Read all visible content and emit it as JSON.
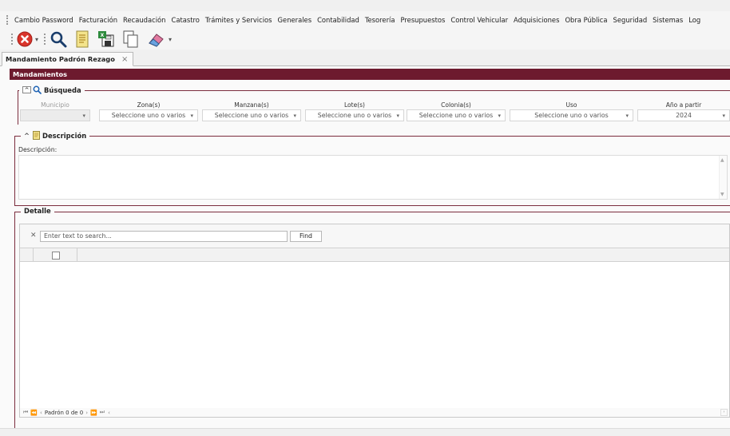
{
  "menu": {
    "items": [
      "Cambio Password",
      "Facturación",
      "Recaudación",
      "Catastro",
      "Trámites y Servicios",
      "Generales",
      "Contabilidad",
      "Tesorería",
      "Presupuestos",
      "Control Vehicular",
      "Adquisiciones",
      "Obra Pública",
      "Seguridad",
      "Sistemas",
      "Log"
    ]
  },
  "toolbar": {
    "icons": [
      "close-red-icon",
      "search-icon",
      "notepad-icon",
      "save-excel-icon",
      "copy-pages-icon",
      "eraser-icon"
    ]
  },
  "tab": {
    "label": "Mandamiento Padrón Rezago",
    "close": "×"
  },
  "header": {
    "title": "Mandamientos"
  },
  "busqueda": {
    "legend": "Búsqueda",
    "fields": {
      "municipio": {
        "label": "Municipio",
        "value": ""
      },
      "zona": {
        "label": "Zona(s)",
        "value": "Seleccione uno o varios"
      },
      "manzana": {
        "label": "Manzana(s)",
        "value": "Seleccione uno o varios"
      },
      "lote": {
        "label": "Lote(s)",
        "value": "Seleccione uno o varios"
      },
      "colonia": {
        "label": "Colonia(s)",
        "value": "Seleccione uno o varios"
      },
      "uso": {
        "label": "Uso",
        "value": "Seleccione uno o varios"
      },
      "anio": {
        "label": "Año a partir",
        "value": "2024"
      }
    }
  },
  "descripcion": {
    "legend": "Descripción",
    "label": "Descripción:"
  },
  "detalle": {
    "legend": "Detalle",
    "search_placeholder": "Enter text to search...",
    "find_label": "Find",
    "pager_text": "Padrón 0 de 0"
  },
  "colors": {
    "accent": "#6d1a2e",
    "border_accent": "#7b2d3e"
  }
}
